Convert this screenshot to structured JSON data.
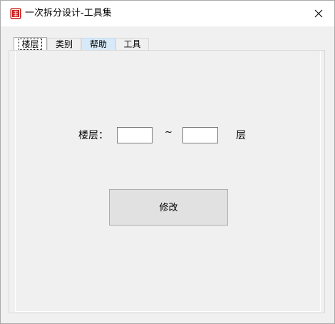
{
  "window": {
    "title": "一次拆分设计-工具集",
    "app_icon": "seal-stamp-icon",
    "close_icon": "close-icon"
  },
  "tabs": [
    {
      "label": "楼层",
      "state": "active"
    },
    {
      "label": "类别",
      "state": "normal"
    },
    {
      "label": "帮助",
      "state": "hover"
    },
    {
      "label": "工具",
      "state": "normal"
    }
  ],
  "floor_form": {
    "floor_label": "楼层：",
    "from_value": "",
    "separator": "~",
    "to_value": "",
    "unit_label": "层",
    "modify_button": "修改"
  },
  "colors": {
    "window_background": "#f0f0f0",
    "titlebar": "#ffffff",
    "icon_red": "#c8201e",
    "hover_tab": "#d8eaf9"
  }
}
